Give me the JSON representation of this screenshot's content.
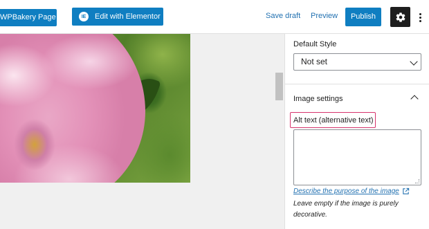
{
  "topbar": {
    "wpbakery_label": "WPBakery Page Builder",
    "elementor_label": "Edit with Elementor",
    "elementor_icon": "elementor-logo-icon",
    "save_draft_label": "Save draft",
    "preview_label": "Preview",
    "publish_label": "Publish",
    "settings_icon": "gear-icon",
    "more_icon": "vertical-ellipsis-icon",
    "accent_color": "#0f7ec1"
  },
  "sidebar": {
    "default_style": {
      "label": "Default Style",
      "selected": "Not set"
    },
    "image_settings": {
      "title": "Image settings",
      "alt_label": "Alt text (alternative text)",
      "alt_value": "",
      "help_link": "Describe the purpose of the image",
      "help_text": "Leave empty if the image is purely decorative.",
      "highlight_color": "#d6336c"
    }
  }
}
